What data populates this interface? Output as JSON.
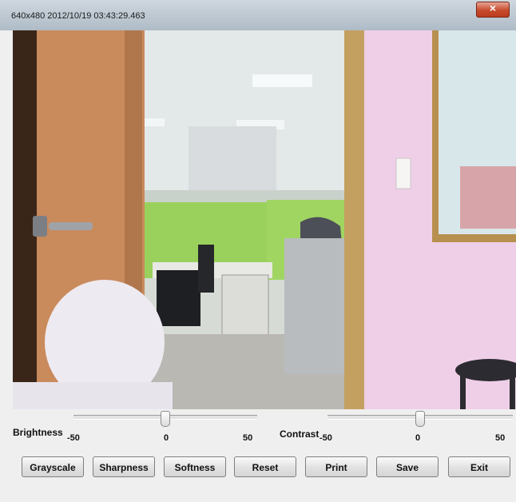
{
  "window": {
    "title": "640x480 2012/10/19 03:43:29.463"
  },
  "brightness": {
    "label": "Brightness",
    "min": "-50",
    "mid": "0",
    "max": "50",
    "level": 0
  },
  "contrast": {
    "label": "Contrast",
    "min": "-50",
    "mid": "0",
    "max": "50",
    "level": 0
  },
  "buttons": {
    "grayscale": "Grayscale",
    "sharpness": "Sharpness",
    "softness": "Softness",
    "reset": "Reset",
    "print": "Print",
    "save": "Save",
    "exit": "Exit"
  },
  "icons": {
    "close": "close-icon"
  },
  "colors": {
    "close": "#c84a2c",
    "title_bar": "#b7c3cd"
  }
}
